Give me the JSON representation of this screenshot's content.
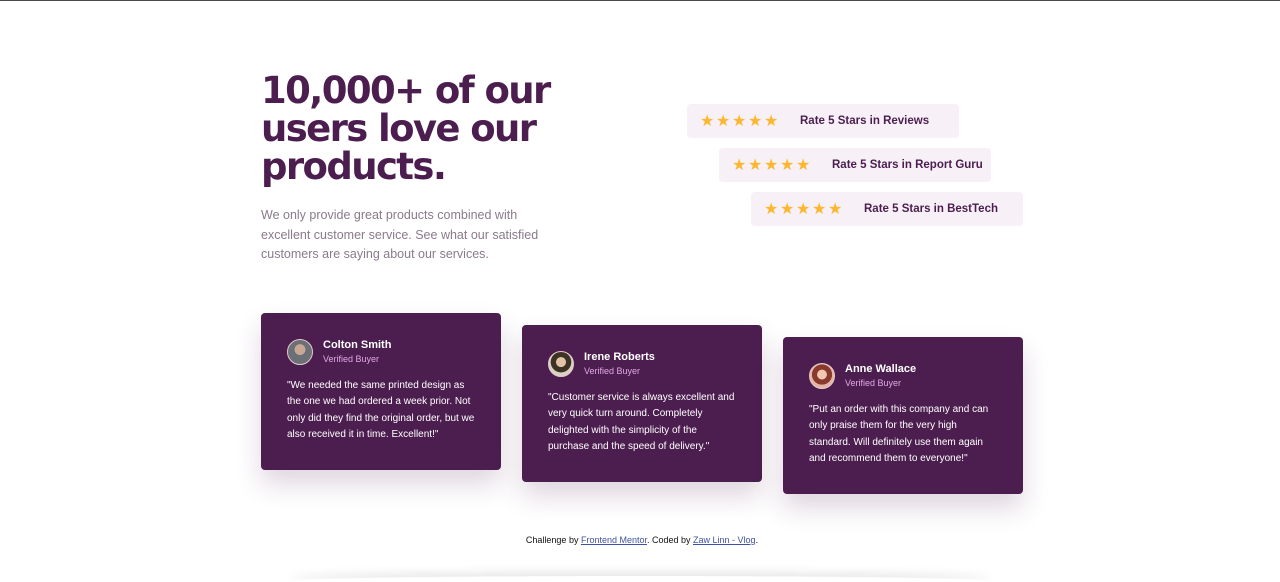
{
  "hero": {
    "headline": "10,000+ of our users love our products.",
    "intro": "We only provide great products combined with excellent customer service. See what our satisfied customers are saying about our services."
  },
  "ratings": [
    {
      "label": "Rate 5 Stars in Reviews",
      "stars": 5
    },
    {
      "label": "Rate 5 Stars in Report Guru",
      "stars": 5
    },
    {
      "label": "Rate 5 Stars in BestTech",
      "stars": 5
    }
  ],
  "testimonials": [
    {
      "name": "Colton Smith",
      "tag": "Verified Buyer",
      "quote": "\"We needed the same printed design as the one we had ordered a week prior. Not only did they find the original order, but we also received it in time. Excellent!\""
    },
    {
      "name": "Irene Roberts",
      "tag": "Verified Buyer",
      "quote": "\"Customer service is always excellent and very quick turn around. Completely delighted with the simplicity of the purchase and the speed of delivery.\""
    },
    {
      "name": "Anne Wallace",
      "tag": "Verified Buyer",
      "quote": "\"Put an order with this company and can only praise them for the very high standard. Will definitely use them again and recommend them to everyone!\""
    }
  ],
  "footer": {
    "prefix": "Challenge by ",
    "link1": "Frontend Mentor",
    "middle": ". Coded by ",
    "link2": "Zaw Linn - Vlog",
    "suffix": "."
  },
  "icons": {
    "star": "star-icon",
    "avatar": "avatar-image"
  },
  "colors": {
    "primary": "#4c1e4f",
    "accent_star": "#fcb72f",
    "rating_bg": "#f7f0f7",
    "muted_text": "#8a7a8b",
    "tag_pink": "#e3a8e6"
  }
}
